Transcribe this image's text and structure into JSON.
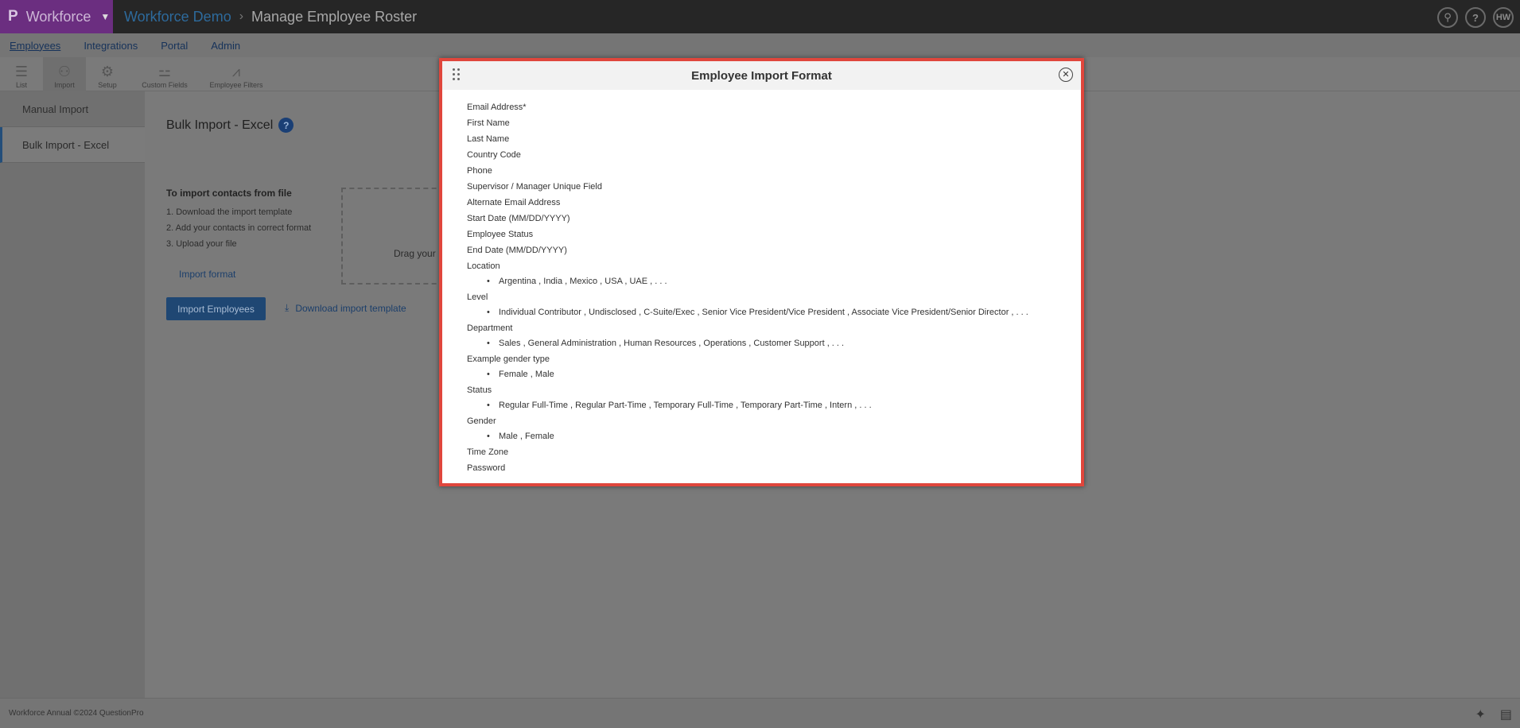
{
  "header": {
    "brand": "Workforce",
    "brand_logo": "P",
    "breadcrumb_root": "Workforce Demo",
    "breadcrumb_current": "Manage Employee Roster",
    "user_initials": "HW"
  },
  "nav": {
    "items": [
      "Employees",
      "Integrations",
      "Portal",
      "Admin"
    ]
  },
  "toolbar": {
    "items": [
      {
        "label": "List",
        "icon": "list-icon"
      },
      {
        "label": "Import",
        "icon": "person-icon"
      },
      {
        "label": "Setup",
        "icon": "gear-icon"
      },
      {
        "label": "Custom Fields",
        "icon": "fields-icon"
      },
      {
        "label": "Employee Filters",
        "icon": "chart-icon"
      }
    ]
  },
  "sidebar": {
    "items": [
      {
        "label": "Manual Import"
      },
      {
        "label": "Bulk Import - Excel"
      }
    ]
  },
  "main": {
    "title": "Bulk Import - Excel",
    "instructions_heading": "To import contacts from file",
    "steps": [
      "1. Download the import template",
      "2. Add your contacts in correct format",
      "3. Upload your file"
    ],
    "import_format_link": "Import format",
    "dropzone_text": "Drag your",
    "import_button": "Import Employees",
    "download_link": "Download import template"
  },
  "footer": {
    "text": "Workforce Annual ©2024 QuestionPro"
  },
  "modal": {
    "title": "Employee Import Format",
    "fields": [
      {
        "name": "Email Address*"
      },
      {
        "name": "First Name"
      },
      {
        "name": "Last Name"
      },
      {
        "name": "Country Code"
      },
      {
        "name": "Phone"
      },
      {
        "name": "Supervisor / Manager Unique Field"
      },
      {
        "name": "Alternate Email Address"
      },
      {
        "name": "Start Date (MM/DD/YYYY)"
      },
      {
        "name": "Employee Status"
      },
      {
        "name": "End Date (MM/DD/YYYY)"
      },
      {
        "name": "Location",
        "values": "Argentina , India , Mexico , USA , UAE , . . ."
      },
      {
        "name": "Level",
        "values": "Individual Contributor , Undisclosed , C-Suite/Exec , Senior Vice President/Vice President , Associate Vice President/Senior Director , . . ."
      },
      {
        "name": "Department",
        "values": "Sales , General Administration , Human Resources , Operations , Customer Support , . . ."
      },
      {
        "name": "Example gender type",
        "values": "Female , Male"
      },
      {
        "name": "Status",
        "values": "Regular Full-Time , Regular Part-Time , Temporary Full-Time , Temporary Part-Time , Intern , . . ."
      },
      {
        "name": "Gender",
        "values": "Male , Female"
      },
      {
        "name": "Time Zone"
      },
      {
        "name": "Password"
      }
    ]
  }
}
